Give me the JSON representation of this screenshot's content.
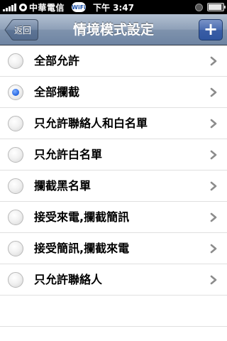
{
  "status_bar": {
    "carrier": "中華電信",
    "wifi_label": "WiFi",
    "time": "下午 3:47",
    "icons": [
      "signal-icon",
      "carrier-icon",
      "wifi-icon",
      "alarm-icon",
      "battery-icon"
    ],
    "battery_level": 0.9
  },
  "nav": {
    "back_label": "返回",
    "title": "情境模式設定",
    "add_label": "+"
  },
  "options": [
    {
      "label": "全部允許",
      "selected": false
    },
    {
      "label": "全部攔截",
      "selected": true
    },
    {
      "label": "只允許聯絡人和白名單",
      "selected": false
    },
    {
      "label": "只允許白名單",
      "selected": false
    },
    {
      "label": "攔截黑名單",
      "selected": false
    },
    {
      "label": "接受來電,攔截簡訊",
      "selected": false
    },
    {
      "label": "接受簡訊,攔截來電",
      "selected": false
    },
    {
      "label": "只允許聯絡人",
      "selected": false
    }
  ],
  "colors": {
    "navbar": "#8ea0b8",
    "add_button": "#3a5da6",
    "radio_selected": "#2f6ee6",
    "chevron": "#8c8c8c"
  }
}
